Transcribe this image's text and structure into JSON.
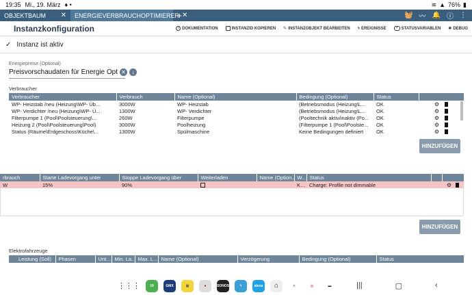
{
  "statusbar": {
    "time": "19:35",
    "date": "Mi., 19. März",
    "battery": "76%"
  },
  "tabs": [
    {
      "label": "OBJEKTBAUM"
    },
    {
      "label": "ENERGIEVERBRAUCHOPTIMIERER"
    }
  ],
  "header": {
    "title": "Instanzkonfiguration",
    "actions": [
      "DOKUMENTATION",
      "INSTANZID KOPIEREN",
      "INSTANZOBJEKT BEARBEITEN",
      "EREIGNISSE",
      "STATUSVARIABLEN",
      "DEBUG"
    ]
  },
  "instance_status": "Instanz ist aktiv",
  "energy_prices": {
    "label": "Energiepreise (Optional)",
    "value": "Preisvorschaudaten für Energie Opt"
  },
  "consumers": {
    "label": "Verbraucher",
    "columns": [
      "Verbraucher",
      "Verbrauch",
      "Name (Optional)",
      "Bedingung (Optional)",
      "Status"
    ],
    "rows": [
      [
        "WP- Heizstab /neu (Heizung\\WP- Üb...",
        "3000W",
        "WP- Heizstab",
        "(Betriebsmodus (Heizung\\L...",
        "OK"
      ],
      [
        "WP- Verdichter /neu (Heizung\\WP- Ü...",
        "1300W",
        "WP- Verdichter",
        "(Betriebsmodus (Heizung\\L...",
        "OK"
      ],
      [
        "Filterpumpe 1 (Pool\\Poolsteuerung\\...",
        "260W",
        "Filterpumpe",
        "(Pooltechnik aktiv/inaktiv (Po...",
        "OK"
      ],
      [
        "Heizung 2 (Pool\\Poolsteuerung\\Pool)",
        "3000W",
        "Poolheizung",
        "(Filterpumpe 1 (Pool\\Poolste...",
        "OK"
      ],
      [
        "Status (Räume\\Erdgeschoss\\Küche\\...",
        "1300W",
        "Spülmaschine",
        "Keine Bedingungen definiert",
        "OK"
      ]
    ],
    "add_label": "HINZUFÜGEN"
  },
  "charging": {
    "columns": [
      "rbrauch",
      "Starte Ladevorgang unter",
      "Stoppe Ladevorgang über",
      "Weiterladen",
      "Name (Option...",
      "W...",
      "Status"
    ],
    "rows": [
      [
        "W",
        "15%",
        "90%",
        "",
        "",
        "K...",
        "Charge: Profile not dimmable"
      ]
    ],
    "add_label": "HINZUFÜGEN"
  },
  "vehicles": {
    "label": "Elektrofahrzeuge",
    "columns": [
      "Leistung (Soll)",
      "Phasen",
      "Unt...",
      "Min. La...",
      "Max. L...",
      "Name (Optional)",
      "Verzögerung",
      "Bedingung (Optional)",
      "Status"
    ]
  },
  "dock_apps": [
    "GMX",
    "SONOS",
    "alexa"
  ],
  "colors": {
    "tabbar": "#3a5f7e",
    "table_header": "#6f859a",
    "error_row": "#f6c4c4",
    "button": "#8a9bab"
  }
}
